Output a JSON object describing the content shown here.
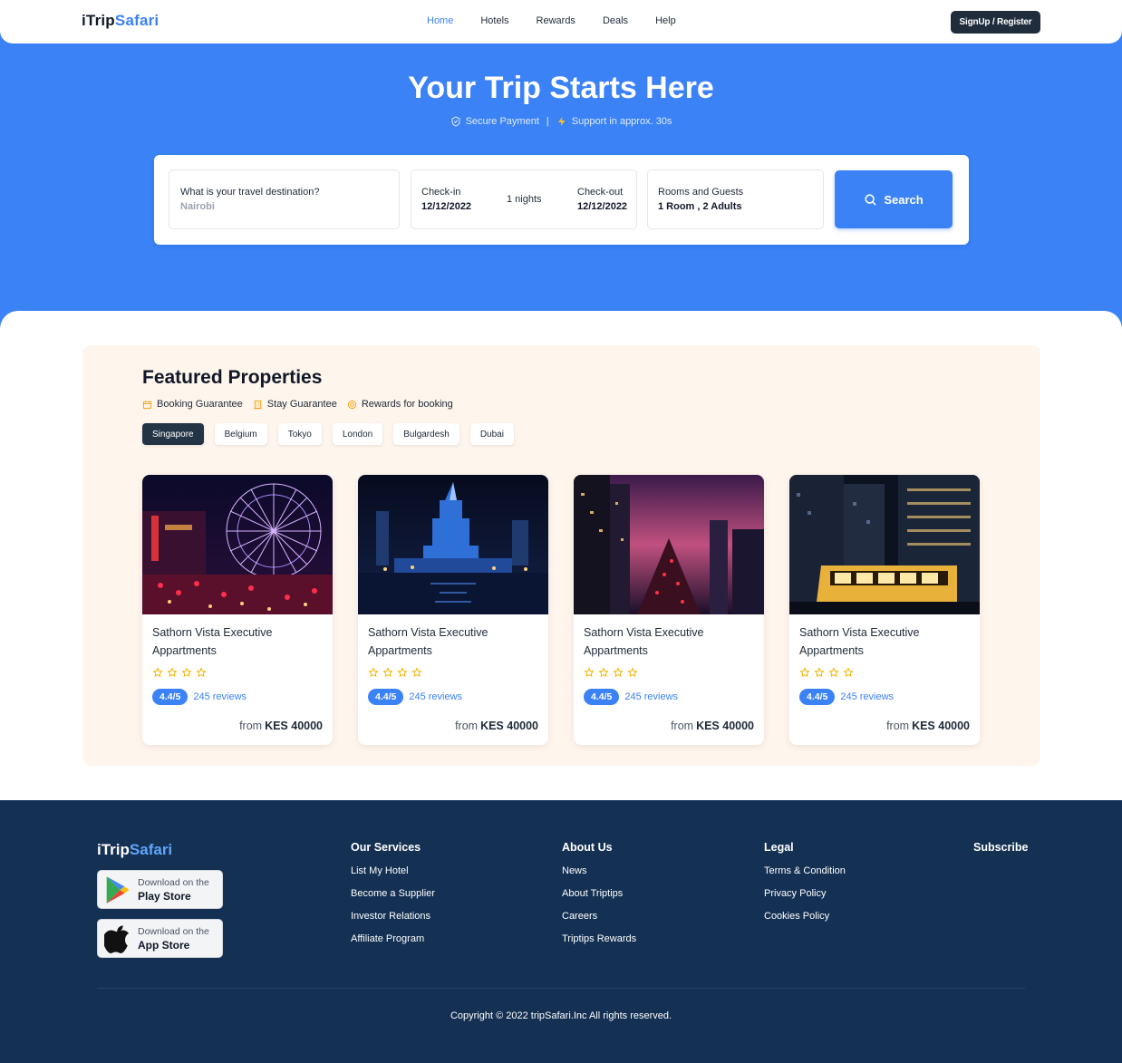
{
  "brand": {
    "part1": "iTrip",
    "part2": "Safari"
  },
  "nav": {
    "items": [
      "Home",
      "Hotels",
      "Rewards",
      "Deals",
      "Help"
    ],
    "active": "Home",
    "signup_label": "SignUp / Register"
  },
  "hero": {
    "title": "Your Trip Starts Here",
    "secure": "Secure Payment",
    "separator": "|",
    "support": "Support in approx. 30s"
  },
  "search": {
    "destination_label": "What is your travel destination?",
    "destination_value": "Nairobi",
    "checkin_label": "Check-in",
    "checkin_value": "12/12/2022",
    "nights": "1 nights",
    "checkout_label": "Check-out",
    "checkout_value": "12/12/2022",
    "rooms_label": "Rooms and Guests",
    "rooms_value": "1 Room , 2 Adults",
    "button_label": "Search"
  },
  "featured": {
    "title": "Featured Properties",
    "badges": [
      "Booking Guarantee",
      "Stay Guarantee",
      "Rewards for booking"
    ],
    "cities": [
      "Singapore",
      "Belgium",
      "Tokyo",
      "London",
      "Bulgardesh",
      "Dubai"
    ],
    "active_city": "Singapore",
    "cards": [
      {
        "name": "Sathorn Vista Executive Appartments",
        "stars": 4,
        "rating": "4.4/5",
        "reviews": "245 reviews",
        "from": "from",
        "price": "KES 40000",
        "image": "ferris-wheel-night"
      },
      {
        "name": "Sathorn Vista Executive Appartments",
        "stars": 4,
        "rating": "4.4/5",
        "reviews": "245 reviews",
        "from": "from",
        "price": "KES 40000",
        "image": "palace-tower-night"
      },
      {
        "name": "Sathorn Vista Executive Appartments",
        "stars": 4,
        "rating": "4.4/5",
        "reviews": "245 reviews",
        "from": "from",
        "price": "KES 40000",
        "image": "city-street-pink-sky"
      },
      {
        "name": "Sathorn Vista Executive Appartments",
        "stars": 4,
        "rating": "4.4/5",
        "reviews": "245 reviews",
        "from": "from",
        "price": "KES 40000",
        "image": "tram-skyscraper-night"
      }
    ]
  },
  "footer": {
    "play_store": {
      "line1": "Download on the",
      "line2": "Play Store"
    },
    "app_store": {
      "line1": "Download on the",
      "line2": "App Store"
    },
    "services": {
      "title": "Our Services",
      "links": [
        "List My Hotel",
        "Become a Supplier",
        "Investor Relations",
        "Affiliate Program"
      ]
    },
    "about": {
      "title": "About Us",
      "links": [
        "News",
        "About Triptips",
        "Careers",
        "Triptips Rewards"
      ]
    },
    "legal": {
      "title": "Legal",
      "links": [
        "Terms & Condition",
        "Privacy Policy",
        "Cookies Policy"
      ]
    },
    "subscribe": {
      "title": "Subscribe"
    },
    "copyright": "Copyright © 2022 tripSafari.Inc All rights reserved."
  },
  "colors": {
    "primary": "#3b82f6",
    "dark": "#143154",
    "featured_bg": "#fef5ec",
    "star": "#f5b301"
  }
}
